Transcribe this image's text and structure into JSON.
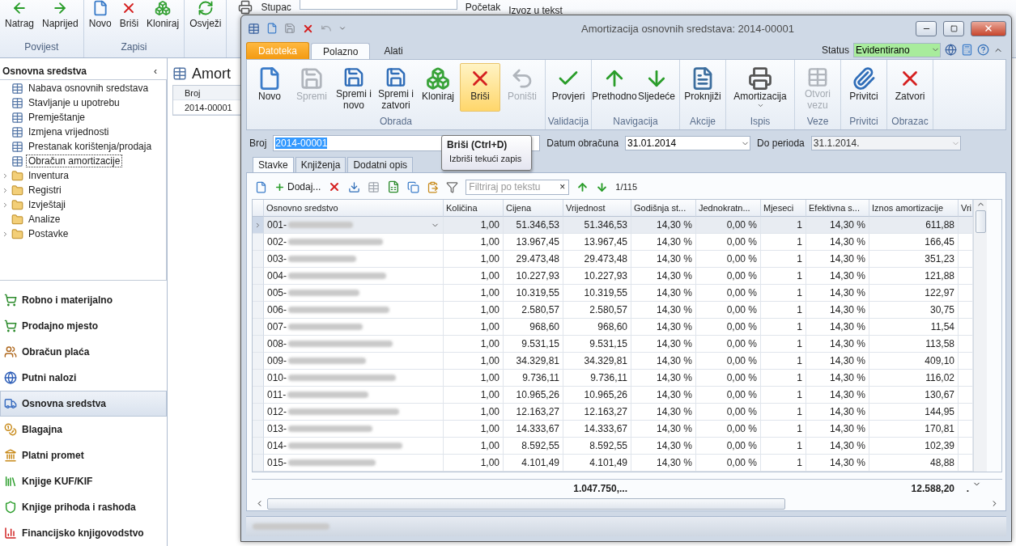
{
  "background_app": {
    "toolbar_groups": [
      {
        "label": "Povijest",
        "buttons": [
          {
            "label": "Natrag",
            "kind": "back"
          },
          {
            "label": "Naprijed",
            "kind": "forward"
          }
        ]
      },
      {
        "label": "Zapisi",
        "buttons": [
          {
            "label": "Novo",
            "kind": "new"
          },
          {
            "label": "Briši",
            "kind": "delete"
          },
          {
            "label": "Kloniraj",
            "kind": "clone"
          }
        ]
      },
      {
        "buttons": [
          {
            "label": "Osvježi",
            "kind": "refresh"
          }
        ]
      }
    ],
    "column_label": "Stupac",
    "start_label": "Početak",
    "export_label": "Izvoz u tekst",
    "sidebar": {
      "title": "Osnovna sredstva",
      "collapse": "‹",
      "tree": [
        {
          "label": "Nabava osnovnih sredstava",
          "kind": "form",
          "selected": false
        },
        {
          "label": "Stavljanje u upotrebu",
          "kind": "form",
          "selected": false
        },
        {
          "label": "Premještanje",
          "kind": "form",
          "selected": false
        },
        {
          "label": "Izmjena vrijednosti",
          "kind": "form",
          "selected": false
        },
        {
          "label": "Prestanak korištenja/prodaja",
          "kind": "form",
          "selected": false
        },
        {
          "label": "Obračun amortizacije",
          "kind": "form",
          "selected": true
        },
        {
          "label": "Inventura",
          "kind": "folder",
          "expanded": false,
          "selected": false
        },
        {
          "label": "Registri",
          "kind": "folder",
          "expanded": false,
          "selected": false
        },
        {
          "label": "Izvještaji",
          "kind": "folder",
          "expanded": false,
          "selected": false
        },
        {
          "label": "Analize",
          "kind": "leaf-folder",
          "selected": false
        },
        {
          "label": "Postavke",
          "kind": "folder",
          "expanded": false,
          "selected": false
        }
      ],
      "modules": [
        {
          "label": "Robno i materijalno",
          "kind": "cart",
          "selected": false
        },
        {
          "label": "Prodajno mjesto",
          "kind": "cart",
          "selected": false
        },
        {
          "label": "Obračun plaća",
          "kind": "people",
          "selected": false
        },
        {
          "label": "Putni nalozi",
          "kind": "globe",
          "selected": false
        },
        {
          "label": "Osnovna sredstva",
          "kind": "truck",
          "selected": true
        },
        {
          "label": "Blagajna",
          "kind": "coins",
          "selected": false
        },
        {
          "label": "Platni promet",
          "kind": "bank",
          "selected": false
        },
        {
          "label": "Knjige KUF/KIF",
          "kind": "books",
          "selected": false
        },
        {
          "label": "Knjige prihoda i rashoda",
          "kind": "shield",
          "selected": false
        },
        {
          "label": "Financijsko knjigovodstvo",
          "kind": "chart",
          "selected": false
        }
      ]
    },
    "document": {
      "title": "Amort",
      "column": "Broj",
      "rows": [
        "2014-00001"
      ]
    }
  },
  "window": {
    "title": "Amortizacija osnovnih sredstava: 2014-00001",
    "ribbon_tabs": [
      {
        "label": "Datoteka",
        "kind": "file",
        "selected": false
      },
      {
        "label": "Polazno",
        "kind": "tab",
        "selected": true
      },
      {
        "label": "Alati",
        "kind": "tab",
        "selected": false
      }
    ],
    "status": {
      "label": "Status",
      "value": "Evidentirano"
    },
    "ribbon_groups": [
      {
        "label": "Obrada",
        "buttons": [
          {
            "label": "Novo",
            "kind": "new",
            "disabled": false,
            "highlighted": false
          },
          {
            "label": "Spremi",
            "kind": "save",
            "disabled": true,
            "highlighted": false
          },
          {
            "label": "Spremi i novo",
            "kind": "save-new",
            "disabled": false,
            "highlighted": false
          },
          {
            "label": "Spremi i zatvori",
            "kind": "save-close",
            "disabled": false,
            "highlighted": false
          },
          {
            "label": "Kloniraj",
            "kind": "clone",
            "disabled": false,
            "highlighted": false
          },
          {
            "label": "Briši",
            "kind": "delete",
            "disabled": false,
            "highlighted": true
          },
          {
            "label": "Poništi",
            "kind": "undo",
            "disabled": true,
            "highlighted": false
          }
        ]
      },
      {
        "label": "Validacija",
        "buttons": [
          {
            "label": "Provjeri",
            "kind": "check",
            "disabled": false,
            "highlighted": false
          }
        ]
      },
      {
        "label": "Navigacija",
        "buttons": [
          {
            "label": "Prethodno",
            "kind": "up",
            "disabled": false,
            "highlighted": false
          },
          {
            "label": "Sljedeće",
            "kind": "down",
            "disabled": false,
            "highlighted": false
          }
        ]
      },
      {
        "label": "Akcije",
        "buttons": [
          {
            "label": "Proknjiži",
            "kind": "post",
            "disabled": false,
            "highlighted": false
          }
        ]
      },
      {
        "label": "Ispis",
        "buttons": [
          {
            "label": "Amortizacija",
            "kind": "print",
            "disabled": false,
            "highlighted": false,
            "dropdown": true
          }
        ]
      },
      {
        "label": "Veze",
        "buttons": [
          {
            "label": "Otvori vezu",
            "kind": "link",
            "disabled": true,
            "highlighted": false
          }
        ]
      },
      {
        "label": "Privitci",
        "buttons": [
          {
            "label": "Privitci",
            "kind": "attach",
            "disabled": false,
            "highlighted": false
          }
        ]
      },
      {
        "label": "Obrazac",
        "buttons": [
          {
            "label": "Zatvori",
            "kind": "close",
            "disabled": false,
            "highlighted": false
          }
        ]
      }
    ],
    "form": {
      "number_label": "Broj",
      "number": "2014-00001",
      "date_label": "Datum obračuna",
      "date": "31.01.2014",
      "period_label": "Do perioda",
      "period": "31.1.2014."
    },
    "tooltip": {
      "title": "Briši (Ctrl+D)",
      "text": "Izbriši tekući zapis"
    },
    "tabs": [
      {
        "label": "Stavke",
        "selected": true
      },
      {
        "label": "Knjiženja",
        "selected": false
      },
      {
        "label": "Dodatni opis",
        "selected": false
      }
    ],
    "grid_toolbar": {
      "add_label": "Dodaj...",
      "filter_placeholder": "Filtriraj po tekstu",
      "clear": "×",
      "position": "1/115"
    },
    "table": {
      "columns": [
        "Osnovno sredstvo",
        "Količina",
        "Cijena",
        "Vrijednost",
        "Godišnja st...",
        "Jednokratn...",
        "Mjeseci",
        "Efektivna s...",
        "Iznos amortizacije",
        "Vri"
      ],
      "rows": [
        {
          "selected": true,
          "cells": [
            "001-",
            "1,00",
            "51.346,53",
            "51.346,53",
            "14,30 %",
            "0,00 %",
            "1",
            "14,30 %",
            "611,88"
          ]
        },
        {
          "selected": false,
          "cells": [
            "002-",
            "1,00",
            "13.967,45",
            "13.967,45",
            "14,30 %",
            "0,00 %",
            "1",
            "14,30 %",
            "166,45"
          ]
        },
        {
          "selected": false,
          "cells": [
            "003-",
            "1,00",
            "29.473,48",
            "29.473,48",
            "14,30 %",
            "0,00 %",
            "1",
            "14,30 %",
            "351,23"
          ]
        },
        {
          "selected": false,
          "cells": [
            "004-",
            "1,00",
            "10.227,93",
            "10.227,93",
            "14,30 %",
            "0,00 %",
            "1",
            "14,30 %",
            "121,88"
          ]
        },
        {
          "selected": false,
          "cells": [
            "005-",
            "1,00",
            "10.319,55",
            "10.319,55",
            "14,30 %",
            "0,00 %",
            "1",
            "14,30 %",
            "122,97"
          ]
        },
        {
          "selected": false,
          "cells": [
            "006-",
            "1,00",
            "2.580,57",
            "2.580,57",
            "14,30 %",
            "0,00 %",
            "1",
            "14,30 %",
            "30,75"
          ]
        },
        {
          "selected": false,
          "cells": [
            "007-",
            "1,00",
            "968,60",
            "968,60",
            "14,30 %",
            "0,00 %",
            "1",
            "14,30 %",
            "11,54"
          ]
        },
        {
          "selected": false,
          "cells": [
            "008-",
            "1,00",
            "9.531,15",
            "9.531,15",
            "14,30 %",
            "0,00 %",
            "1",
            "14,30 %",
            "113,58"
          ]
        },
        {
          "selected": false,
          "cells": [
            "009-",
            "1,00",
            "34.329,81",
            "34.329,81",
            "14,30 %",
            "0,00 %",
            "1",
            "14,30 %",
            "409,10"
          ]
        },
        {
          "selected": false,
          "cells": [
            "010-",
            "1,00",
            "9.736,11",
            "9.736,11",
            "14,30 %",
            "0,00 %",
            "1",
            "14,30 %",
            "116,02"
          ]
        },
        {
          "selected": false,
          "cells": [
            "011-",
            "1,00",
            "10.965,26",
            "10.965,26",
            "14,30 %",
            "0,00 %",
            "1",
            "14,30 %",
            "130,67"
          ]
        },
        {
          "selected": false,
          "cells": [
            "012-",
            "1,00",
            "12.163,27",
            "12.163,27",
            "14,30 %",
            "0,00 %",
            "1",
            "14,30 %",
            "144,95"
          ]
        },
        {
          "selected": false,
          "cells": [
            "013-",
            "1,00",
            "14.333,67",
            "14.333,67",
            "14,30 %",
            "0,00 %",
            "1",
            "14,30 %",
            "170,81"
          ]
        },
        {
          "selected": false,
          "cells": [
            "014-",
            "1,00",
            "8.592,55",
            "8.592,55",
            "14,30 %",
            "0,00 %",
            "1",
            "14,30 %",
            "102,39"
          ]
        },
        {
          "selected": false,
          "cells": [
            "015-",
            "1,00",
            "4.101,49",
            "4.101,49",
            "14,30 %",
            "0,00 %",
            "1",
            "14,30 %",
            "48,88"
          ]
        }
      ],
      "totals": {
        "value": "1.047.750,...",
        "amount": "12.588,20",
        "last": "."
      }
    }
  }
}
